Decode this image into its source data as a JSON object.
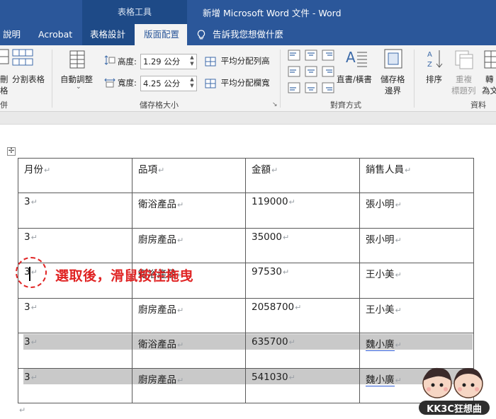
{
  "titlebar": {
    "context_group": "表格工具",
    "doc_title": "新增 Microsoft Word 文件  -  Word"
  },
  "tabs": [
    {
      "label": "說明"
    },
    {
      "label": "Acrobat"
    },
    {
      "label": "表格設計"
    },
    {
      "label": "版面配置"
    }
  ],
  "tell_me": "告訴我您想做什麼",
  "ribbon": {
    "left_labels": {
      "a": "刪",
      "b": "格",
      "c": "併"
    },
    "split_table": "分割表格",
    "auto_adjust": "自動調整",
    "height_label": "高度:",
    "height_value": "1.29 公分",
    "width_label": "寬度:",
    "width_value": "4.25 公分",
    "distribute_rows": "平均分配列高",
    "distribute_cols": "平均分配欄寬",
    "cell_size_group": "儲存格大小",
    "alignment_group": "對齊方式",
    "text_direction": "直書/橫書",
    "cell_margins_1": "儲存格",
    "cell_margins_2": "邊界",
    "sort": "排序",
    "repeat_header_1": "重複",
    "repeat_header_2": "標題列",
    "convert_1": "轉",
    "convert_2": "為文",
    "data_group": "資料"
  },
  "table": {
    "headers": [
      "月份",
      "品項",
      "金額",
      "銷售人員"
    ],
    "rows": [
      [
        "3",
        "衛浴產品",
        "119000",
        "張小明"
      ],
      [
        "3",
        "廚房產品",
        "35000",
        "張小明"
      ],
      [
        "3",
        "衛浴產品",
        "97530",
        "王小美"
      ],
      [
        "3",
        "廚房產品",
        "2058700",
        "王小美"
      ],
      [
        "3",
        "衛浴產品",
        "635700",
        "魏小廣"
      ],
      [
        "3",
        "廚房產品",
        "541030",
        "魏小廣"
      ]
    ]
  },
  "annotation": "選取後，滑鼠按住拖曳",
  "logo_text": "KK3C狂想曲",
  "colors": {
    "word_blue": "#2b579a",
    "annotation_red": "#e02424",
    "selection_gray": "#c9c9c9"
  }
}
